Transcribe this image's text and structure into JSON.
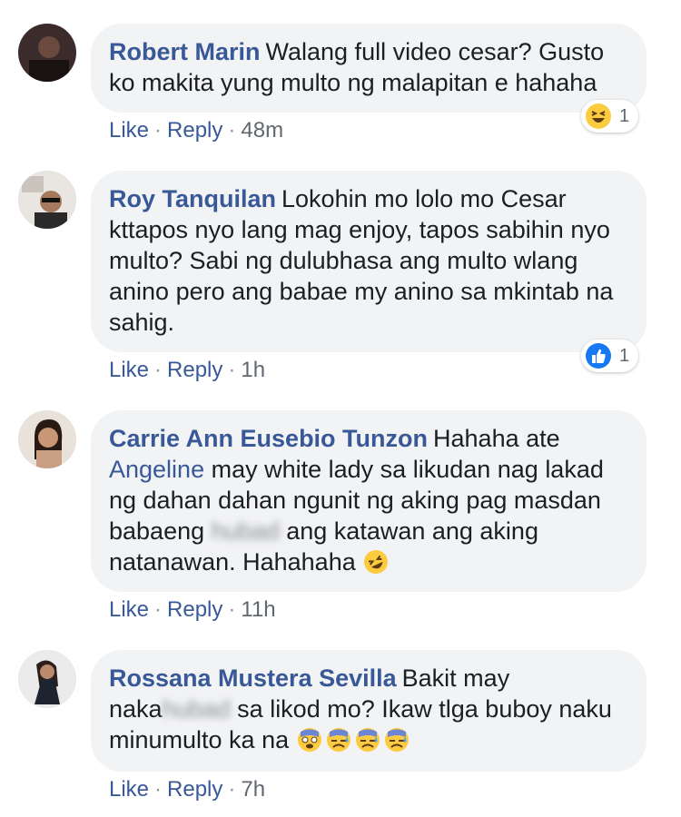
{
  "comments": [
    {
      "author": "Robert Marin",
      "text": "Walang full video cesar? Gusto ko makita yung multo ng malapitan e hahaha",
      "like": "Like",
      "reply": "Reply",
      "time": "48m",
      "reaction": {
        "type": "haha",
        "count": "1"
      }
    },
    {
      "author": "Roy Tanquilan",
      "text": "Lokohin mo lolo mo Cesar kttapos nyo lang mag enjoy, tapos sabihin nyo multo? Sabi ng dulubhasa ang multo wlang anino pero ang babae my anino sa mkintab na sahig.",
      "like": "Like",
      "reply": "Reply",
      "time": "1h",
      "reaction": {
        "type": "like",
        "count": "1"
      }
    },
    {
      "author": "Carrie Ann Eusebio Tunzon",
      "text_a": "Hahaha ate",
      "mention": "Angeline",
      "text_b": "may white lady sa likudan nag lakad ng dahan dahan ngunit ng aking pag masdan babaeng",
      "blurred": "hubad",
      "text_c": "ang katawan ang aking natanawan. Hahahaha",
      "like": "Like",
      "reply": "Reply",
      "time": "11h"
    },
    {
      "author": "Rossana Mustera Sevilla",
      "text_a": "Bakit may naka",
      "blurred": "hubad",
      "text_b": "sa likod mo? Ikaw tlga buboy naku minumulto ka na",
      "like": "Like",
      "reply": "Reply",
      "time": "7h"
    }
  ],
  "separator": "·",
  "colors": {
    "link": "#385898",
    "bubble": "#f2f3f5",
    "text": "#1c1e21",
    "meta": "#606770",
    "like_blue": "#1877f2",
    "emoji_yellow": "#fdcb3f"
  }
}
